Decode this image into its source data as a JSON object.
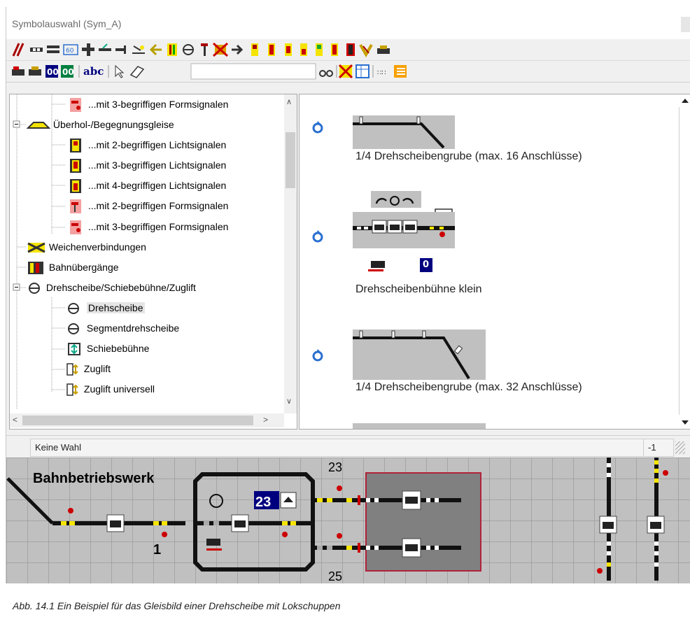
{
  "window": {
    "title": "Symbolauswahl (Sym_A)"
  },
  "toolbar2": {
    "search_placeholder": "",
    "counters": [
      "00",
      "00"
    ],
    "abc_label": "abc"
  },
  "tree": {
    "items": [
      {
        "label": "...mit 3-begriffigen Formsignalen"
      },
      {
        "label": "Überhol-/Begegnungsgleise"
      },
      {
        "label": "...mit 2-begriffigen Lichtsignalen"
      },
      {
        "label": "...mit 3-begriffigen Lichtsignalen"
      },
      {
        "label": "...mit 4-begriffigen Lichtsignalen"
      },
      {
        "label": "...mit 2-begriffigen Formsignalen"
      },
      {
        "label": "...mit 3-begriffigen Formsignalen"
      },
      {
        "label": "Weichenverbindungen"
      },
      {
        "label": "Bahnübergänge"
      },
      {
        "label": "Drehscheibe/Schiebebühne/Zuglift"
      },
      {
        "label": "Drehscheibe"
      },
      {
        "label": "Segmentdrehscheibe"
      },
      {
        "label": "Schiebebühne"
      },
      {
        "label": "Zuglift"
      },
      {
        "label": "Zuglift universell"
      }
    ],
    "expand_minus": "−"
  },
  "preview": {
    "items": [
      {
        "caption": "1/4 Drehscheibengrube (max. 16 Anschlüsse)"
      },
      {
        "caption": "Drehscheibenbühne klein",
        "counter": "0"
      },
      {
        "caption": "1/4 Drehscheibengrube (max. 32 Anschlüsse)"
      }
    ]
  },
  "status": {
    "text": "Keine Wahl",
    "value": "-1"
  },
  "trackplan": {
    "title": "Bahnbetriebswerk",
    "turntable_number": "23",
    "labels": {
      "left_track": "1",
      "top_track": "23",
      "bottom_track": "25"
    }
  },
  "figure_caption": "Abb. 14.1    Ein Beispiel für das Gleisbild einer Drehscheibe mit Lokschuppen",
  "colors": {
    "track": "#1a1a1a",
    "signal_yellow": "#f5e400",
    "signal_red": "#e00000",
    "shed": "#808080",
    "shed_border": "#b0223a",
    "grid_bg": "#c0c0c0",
    "highlight_blue": "#00007f"
  }
}
